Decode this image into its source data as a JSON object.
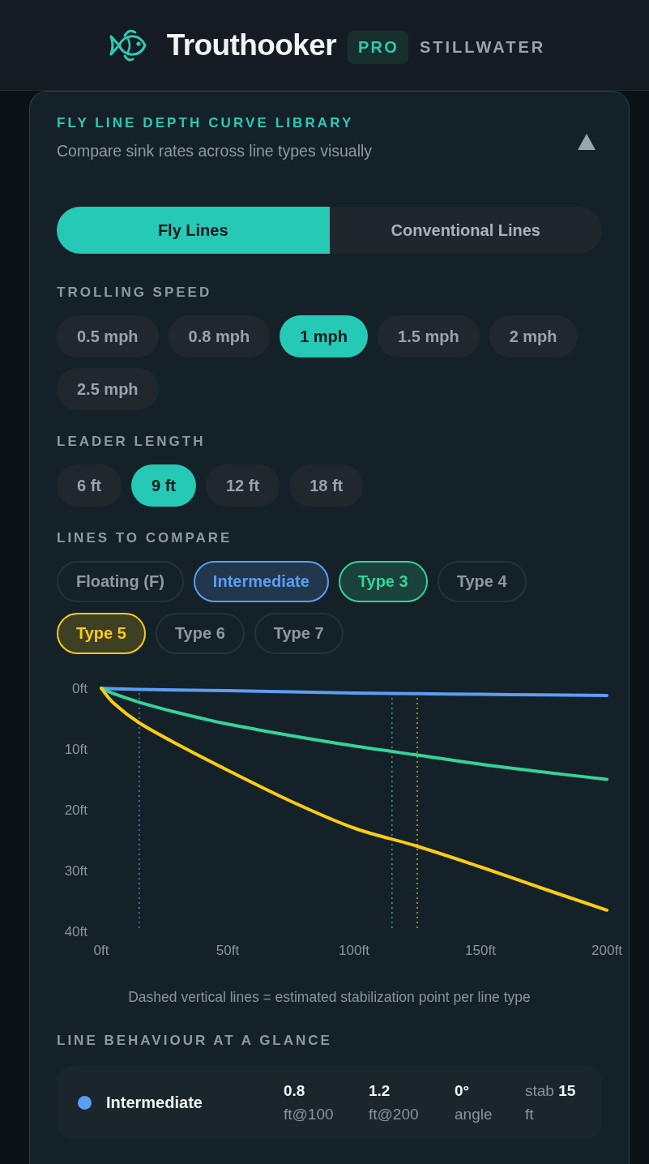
{
  "header": {
    "brand": "Trouthooker",
    "badge": "PRO",
    "mode": "STILLWATER"
  },
  "panel": {
    "title": "FLY LINE DEPTH CURVE LIBRARY",
    "subtitle": "Compare sink rates across line types visually",
    "expanded": true
  },
  "tabs": [
    {
      "label": "Fly Lines",
      "selected": true
    },
    {
      "label": "Conventional Lines",
      "selected": false
    }
  ],
  "trolling_speed": {
    "label": "TROLLING SPEED",
    "options": [
      {
        "label": "0.5 mph",
        "selected": false
      },
      {
        "label": "0.8 mph",
        "selected": false
      },
      {
        "label": "1 mph",
        "selected": true
      },
      {
        "label": "1.5 mph",
        "selected": false
      },
      {
        "label": "2 mph",
        "selected": false
      },
      {
        "label": "2.5 mph",
        "selected": false
      }
    ]
  },
  "leader_length": {
    "label": "LEADER LENGTH",
    "options": [
      {
        "label": "6 ft",
        "selected": false
      },
      {
        "label": "9 ft",
        "selected": true
      },
      {
        "label": "12 ft",
        "selected": false
      },
      {
        "label": "18 ft",
        "selected": false
      }
    ]
  },
  "lines_to_compare": {
    "label": "LINES TO COMPARE",
    "options": [
      {
        "label": "Floating (F)",
        "selected": false
      },
      {
        "label": "Intermediate",
        "selected": true,
        "color": "#5b9ef5"
      },
      {
        "label": "Type 3",
        "selected": true,
        "color": "#34d399"
      },
      {
        "label": "Type 4",
        "selected": false
      },
      {
        "label": "Type 5",
        "selected": true,
        "color": "#facc15"
      },
      {
        "label": "Type 6",
        "selected": false
      },
      {
        "label": "Type 7",
        "selected": false
      }
    ]
  },
  "depth_chart": {
    "chart_data": {
      "type": "line",
      "x": [
        0,
        5,
        15,
        30,
        50,
        75,
        100,
        125,
        150,
        175,
        200
      ],
      "series": [
        {
          "color": "#5b9ef5",
          "values": [
            0,
            0.1,
            0.2,
            0.3,
            0.4,
            0.6,
            0.8,
            0.9,
            1.0,
            1.1,
            1.2
          ]
        },
        {
          "color": "#34d399",
          "values": [
            0,
            0.9,
            2.3,
            4.0,
            5.9,
            7.8,
            9.5,
            11.0,
            12.5,
            13.8,
            15.0
          ]
        },
        {
          "color": "#facc15",
          "values": [
            0,
            2.5,
            5.7,
            9.2,
            13.5,
            18.6,
            23.0,
            26.0,
            29.4,
            33.0,
            36.5
          ]
        }
      ],
      "xlim": [
        0,
        200
      ],
      "ylim": [
        40,
        0
      ],
      "xticks": [
        {
          "value": 0,
          "label": "0ft"
        },
        {
          "value": 50,
          "label": "50ft"
        },
        {
          "value": 100,
          "label": "100ft"
        },
        {
          "value": 150,
          "label": "150ft"
        },
        {
          "value": 200,
          "label": "200ft"
        }
      ],
      "yticks": [
        {
          "value": 0,
          "label": "0ft"
        },
        {
          "value": 10,
          "label": "10ft"
        },
        {
          "value": 20,
          "label": "20ft"
        },
        {
          "value": 30,
          "label": "30ft"
        },
        {
          "value": 40,
          "label": "40ft"
        }
      ],
      "ref_lines": [
        {
          "axis": "x",
          "value": 15,
          "color": "#5b9ef5"
        },
        {
          "axis": "x",
          "value": 115,
          "color": "#34d399"
        },
        {
          "axis": "x",
          "value": 125,
          "color": "#facc15"
        }
      ]
    },
    "caption": "Dashed vertical lines = estimated stabilization point per line type"
  },
  "behaviour": {
    "label": "LINE BEHAVIOUR AT A GLANCE",
    "rows": [
      {
        "name": "Intermediate",
        "color": "#5b9ef5",
        "stats": [
          {
            "kind": "figure",
            "value": "0.8",
            "unit": "ft@100"
          },
          {
            "kind": "figure",
            "value": "1.2",
            "unit": "ft@200"
          },
          {
            "kind": "figure",
            "value": "0°",
            "unit": "angle"
          },
          {
            "kind": "inline",
            "value": "stab **15**",
            "unit": "ft"
          }
        ]
      }
    ]
  }
}
